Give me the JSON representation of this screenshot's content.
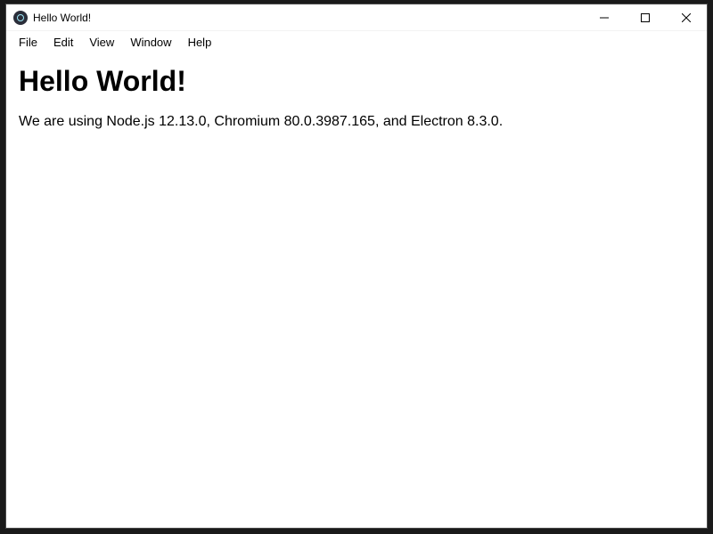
{
  "titlebar": {
    "title": "Hello World!"
  },
  "menubar": {
    "items": [
      "File",
      "Edit",
      "View",
      "Window",
      "Help"
    ]
  },
  "content": {
    "heading": "Hello World!",
    "body": "We are using Node.js 12.13.0, Chromium 80.0.3987.165, and Electron 8.3.0."
  }
}
